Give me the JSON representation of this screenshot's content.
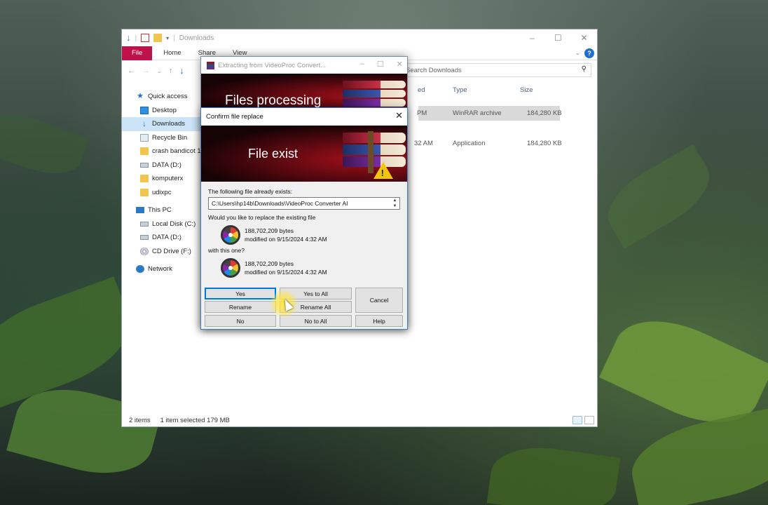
{
  "explorer": {
    "title": "Downloads",
    "ribbon_tabs": [
      "File",
      "Home",
      "Share",
      "View"
    ],
    "search_placeholder": "Search Downloads",
    "nav": {
      "quick_access": "Quick access",
      "desktop": "Desktop",
      "downloads": "Downloads",
      "recycle_bin": "Recycle Bin",
      "crash_bandicoot": "crash bandicot 1",
      "data_d_quick": "DATA (D:)",
      "komputerx": "komputerx",
      "udixpc": "udixpc",
      "this_pc": "This PC",
      "local_disk": "Local Disk (C:)",
      "data_d": "DATA (D:)",
      "cd_drive": "CD Drive (F:)",
      "network": "Network"
    },
    "columns": {
      "modified": "ed",
      "type": "Type",
      "size": "Size"
    },
    "rows": [
      {
        "modified": "PM",
        "type": "WinRAR archive",
        "size": "184,280 KB"
      },
      {
        "modified": "32 AM",
        "type": "Application",
        "size": "184,280 KB"
      }
    ],
    "status": {
      "items": "2 items",
      "selected": "1 item selected  179 MB"
    }
  },
  "extract_window": {
    "title": "Extracting from VideoProc Convert...",
    "banner_text": "Files processing"
  },
  "confirm": {
    "title": "Confirm file replace",
    "banner_text": "File exist",
    "exists_label": "The following file already exists:",
    "path": "C:\\Users\\hp14b\\Downloads\\VideoProc Converter AI",
    "replace_question": "Would you like to replace the existing file",
    "existing": {
      "size": "188,702,209 bytes",
      "modified": "modified on 9/15/2024 4:32 AM"
    },
    "with_label": "with this one?",
    "new": {
      "size": "188,702,209 bytes",
      "modified": "modified on 9/15/2024 4:32 AM"
    },
    "buttons": {
      "yes": "Yes",
      "yes_to_all": "Yes to All",
      "cancel": "Cancel",
      "rename": "Rename",
      "rename_all": "Rename All",
      "no": "No",
      "no_to_all": "No to All",
      "help": "Help"
    }
  },
  "colors": {
    "file_tab": "#c0124a",
    "accent": "#0078d7",
    "banner_red": "#a41018"
  }
}
